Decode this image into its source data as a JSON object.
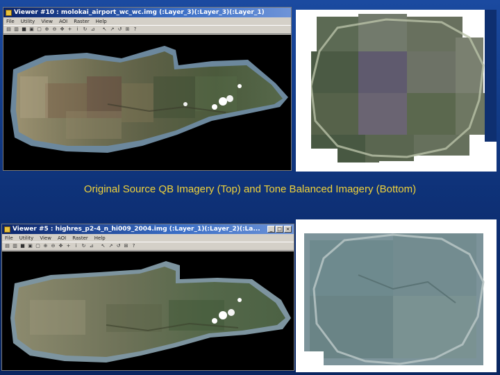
{
  "top_viewer": {
    "title": "Viewer #10 : molokai_airport_wc_wc.img (:Layer_3)(:Layer_3)(:Layer_1)",
    "menu": [
      "File",
      "Utility",
      "View",
      "AOI",
      "Raster",
      "Help"
    ],
    "toolbar_icons": [
      "open-icon",
      "print-icon",
      "save-icon",
      "copy-icon",
      "clear-icon",
      "zoom-in-icon",
      "zoom-out-icon",
      "pan-icon",
      "query-icon",
      "info-icon",
      "refresh-icon",
      "measure-icon",
      "select-icon",
      "pointer-icon",
      "rotate-icon",
      "roam-icon",
      "link-icon",
      "help-icon"
    ]
  },
  "bottom_viewer": {
    "title": "Viewer #5 : highres_p2-4_n_hi009_2004.img (:Layer_1)(:Layer_2)(:La...",
    "menu": [
      "File",
      "Utility",
      "View",
      "AOI",
      "Raster",
      "Help"
    ],
    "toolbar_icons": [
      "open-icon",
      "print-icon",
      "save-icon",
      "copy-icon",
      "clear-icon",
      "zoom-in-icon",
      "zoom-out-icon",
      "pan-icon",
      "query-icon",
      "info-icon",
      "refresh-icon",
      "measure-icon",
      "select-icon",
      "pointer-icon",
      "rotate-icon",
      "roam-icon",
      "link-icon",
      "help-icon"
    ]
  },
  "caption": "Original Source QB Imagery (Top) and Tone Balanced Imagery (Bottom)",
  "colors": {
    "caption": "#f0d23a",
    "slide_background": "#123b87",
    "titlebar": "#0a246a"
  }
}
